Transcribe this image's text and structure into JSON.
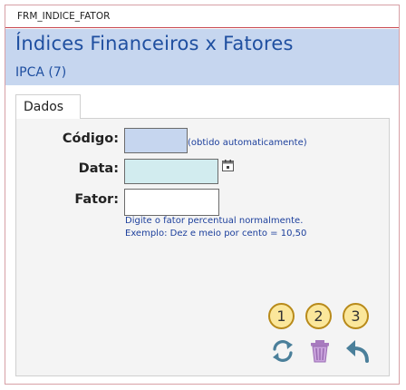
{
  "window": {
    "caption": "FRM_INDICE_FATOR"
  },
  "header": {
    "title": "Índices Financeiros x Fatores",
    "subtitle": "IPCA (7)"
  },
  "tabs": [
    {
      "label": "Dados"
    }
  ],
  "form": {
    "codigo": {
      "label": "Código:",
      "value": "",
      "hint": "(obtido automaticamente)"
    },
    "data": {
      "label": "Data:",
      "value": ""
    },
    "fator": {
      "label": "Fator:",
      "value": "",
      "hint_line1": "Digite o fator percentual normalmente.",
      "hint_line2": "Exemplo: Dez e meio por cento = 10,50"
    }
  },
  "markers": [
    "1",
    "2",
    "3"
  ],
  "actions": [
    {
      "icon": "refresh-icon",
      "color": "#4a7f9a"
    },
    {
      "icon": "trash-icon",
      "color": "#b48ac9"
    },
    {
      "icon": "undo-icon",
      "color": "#4a7f9a"
    }
  ],
  "colors": {
    "header_bg": "#c6d6ef",
    "accent_text": "#1f4fa0",
    "codigo_bg": "#c6d6ef",
    "data_bg": "#d2ecef"
  }
}
